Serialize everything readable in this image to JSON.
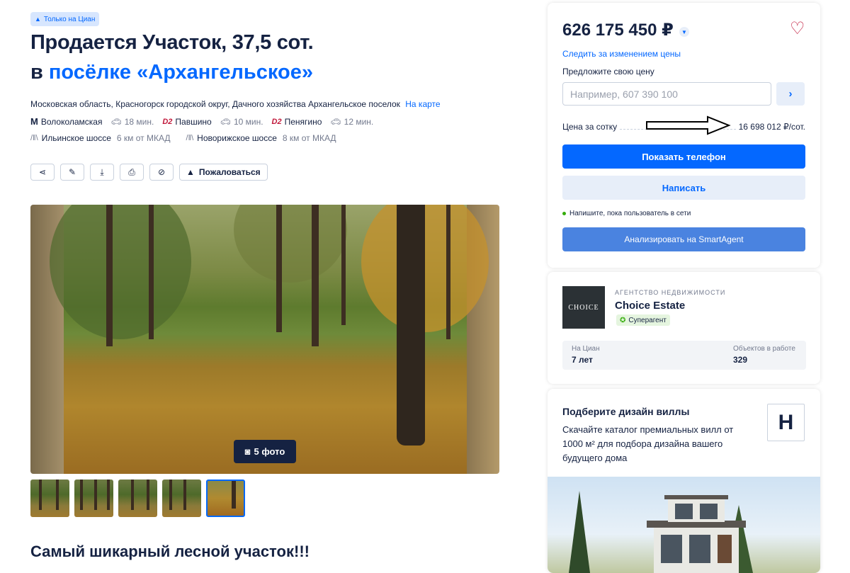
{
  "badge": {
    "label": "Только на Циан",
    "icon": "cian-icon"
  },
  "title": {
    "line1": "Продается Участок, 37,5 сот.",
    "prefix": "в",
    "link": "посёлке «Архангельское»"
  },
  "address": {
    "text": "Московская область, Красногорск городской округ, Дачного хозяйства Архангельское поселок",
    "map_link": "На карте"
  },
  "stations": [
    {
      "type": "metro",
      "icon": "metro-icon",
      "name": "Волоколамская",
      "time": "18 мин."
    },
    {
      "type": "d2",
      "icon": "d2-icon",
      "name": "Павшино",
      "time": "10 мин."
    },
    {
      "type": "d2",
      "icon": "d2-icon",
      "name": "Пенягино",
      "time": "12 мин."
    }
  ],
  "highways": [
    {
      "name": "Ильинское шоссе",
      "distance": "6 км от МКАД"
    },
    {
      "name": "Новорижское шоссе",
      "distance": "8 км от МКАД"
    }
  ],
  "toolbar": {
    "complain_label": "Пожаловаться"
  },
  "gallery": {
    "photo_count": "5 фото",
    "thumbnails": 5,
    "active_thumb": 5
  },
  "description_title": "Самый шикарный лесной участок!!!",
  "price_card": {
    "price": "626 175 450 ₽",
    "track_link": "Следить за изменением цены",
    "offer_label": "Предложите свою цену",
    "offer_placeholder": "Например, 607 390 100",
    "per_unit_label": "Цена за сотку",
    "per_unit_value": "16 698 012 ₽/сот.",
    "phone_button": "Показать телефон",
    "write_button": "Написать",
    "online_note": "Напишите, пока пользователь в сети",
    "smart_button": "Анализировать на SmartAgent"
  },
  "agency": {
    "logo_text": "CHOICE",
    "label": "АГЕНТСТВО НЕДВИЖИМОСТИ",
    "name": "Choice Estate",
    "badge": "Суперагент",
    "stats": [
      {
        "label": "На Циан",
        "value": "7 лет"
      },
      {
        "label": "Объектов в работе",
        "value": "329"
      }
    ]
  },
  "ad": {
    "title": "Подберите дизайн виллы",
    "text": "Скачайте каталог премиальных вилл от 1000 м² для подбора дизайна вашего будущего дома",
    "logo": "H"
  },
  "colors": {
    "accent": "#0468ff",
    "text": "#152242",
    "favorite": "#c11a3c"
  }
}
